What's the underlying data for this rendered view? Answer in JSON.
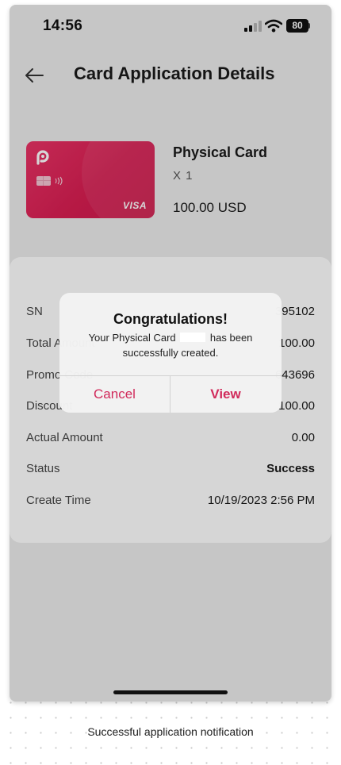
{
  "status_bar": {
    "time": "14:56",
    "battery": "80"
  },
  "header": {
    "title": "Card Application Details"
  },
  "product": {
    "card_brand": "VISA",
    "name": "Physical Card",
    "quantity": "X 1",
    "price": "100.00 USD"
  },
  "details": [
    {
      "label": "SN",
      "value": "395102"
    },
    {
      "label": "Total Amount",
      "value": "100.00"
    },
    {
      "label": "Promo Code",
      "value": "643696"
    },
    {
      "label": "Discount",
      "value": "100.00"
    },
    {
      "label": "Actual Amount",
      "value": "0.00"
    },
    {
      "label": "Status",
      "value": "Success"
    },
    {
      "label": "Create Time",
      "value": "10/19/2023 2:56 PM"
    }
  ],
  "dialog": {
    "title": "Congratulations!",
    "message_pre": "Your Physical Card",
    "message_post": "has been successfully created.",
    "cancel_label": "Cancel",
    "view_label": "View"
  },
  "caption": "Successful application notification",
  "colors": {
    "accent": "#d12a5b",
    "card": "#d91e52",
    "background": "#ececec"
  }
}
